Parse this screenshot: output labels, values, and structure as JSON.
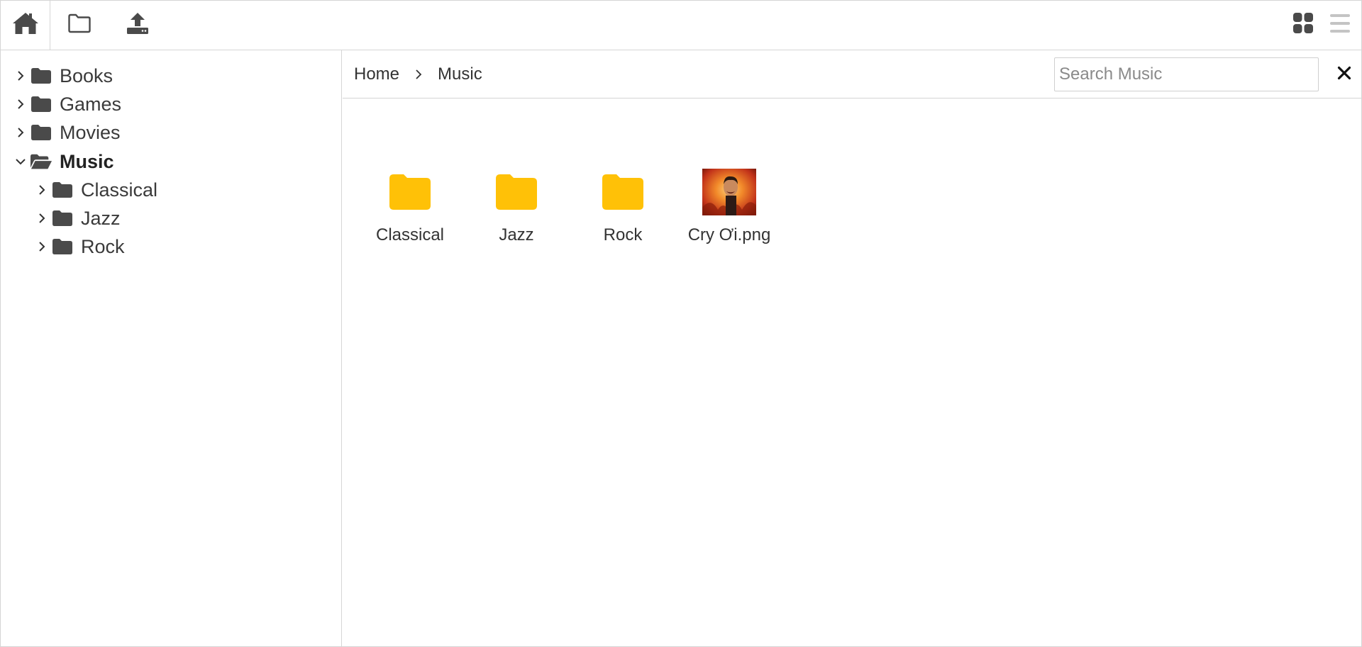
{
  "colors": {
    "folder_yellow": "#ffc107",
    "icon_dark": "#4a4a4a",
    "border": "#d5d5d5"
  },
  "toolbar": {
    "left_icons": [
      "home-icon",
      "folder-icon",
      "upload-icon"
    ],
    "right_icons": [
      "grid-view-icon",
      "list-view-icon"
    ]
  },
  "sidebar": {
    "items": [
      {
        "label": "Books",
        "expanded": false,
        "level": 0,
        "icon": "folder-icon"
      },
      {
        "label": "Games",
        "expanded": false,
        "level": 0,
        "icon": "folder-icon"
      },
      {
        "label": "Movies",
        "expanded": false,
        "level": 0,
        "icon": "folder-icon"
      },
      {
        "label": "Music",
        "expanded": true,
        "level": 0,
        "icon": "folder-open-icon",
        "active": true
      },
      {
        "label": "Classical",
        "expanded": false,
        "level": 1,
        "icon": "folder-icon"
      },
      {
        "label": "Jazz",
        "expanded": false,
        "level": 1,
        "icon": "folder-icon"
      },
      {
        "label": "Rock",
        "expanded": false,
        "level": 1,
        "icon": "folder-icon"
      }
    ]
  },
  "breadcrumb": {
    "items": [
      "Home",
      "Music"
    ]
  },
  "search": {
    "placeholder": "Search Music",
    "value": ""
  },
  "files": [
    {
      "name": "Classical",
      "type": "folder"
    },
    {
      "name": "Jazz",
      "type": "folder"
    },
    {
      "name": "Rock",
      "type": "folder"
    },
    {
      "name": "Cry Ơi.png",
      "type": "image"
    }
  ]
}
